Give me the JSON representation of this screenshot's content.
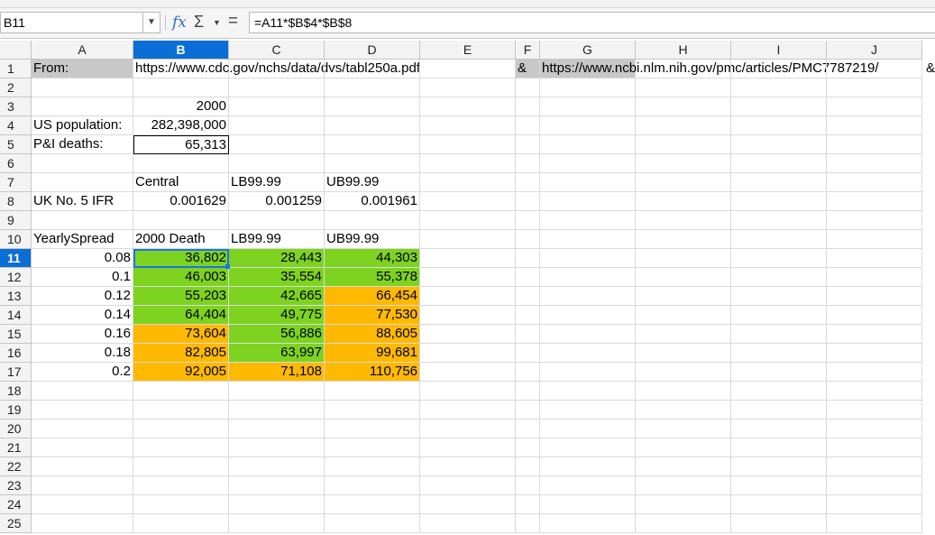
{
  "window": {
    "title": ""
  },
  "formula_bar": {
    "name_box": "B11",
    "formula": "=A11*$B$4*$B$8",
    "fx_icon": "fx-function-wizard-icon",
    "sum_icon": "sum-icon",
    "equals_icon": "equals-icon"
  },
  "colors": {
    "green": "#7ed321",
    "orange": "#ffb900",
    "selection": "#0b6ed7",
    "grey": "#c8c8c8"
  },
  "columns": [
    "A",
    "B",
    "C",
    "D",
    "E",
    "F",
    "G",
    "H",
    "I",
    "J"
  ],
  "selected_column": "B",
  "selected_row": "11",
  "rows": [
    "1",
    "2",
    "3",
    "4",
    "5",
    "6",
    "7",
    "8",
    "9",
    "10",
    "11",
    "12",
    "13",
    "14",
    "15",
    "16",
    "17",
    "18",
    "19",
    "20",
    "21",
    "22",
    "23",
    "24",
    "25"
  ],
  "cells": {
    "A1": "From:",
    "B1": "https://www.cdc.gov/nchs/data/dvs/tabl250a.pdf",
    "F1": "&",
    "G1": "https://www.ncbi.nlm.nih.gov/pmc/articles/PMC7787219/",
    "J1_overflow": "&",
    "B3": "2000",
    "A4": "US population:",
    "B4": "282,398,000",
    "A5": "P&I deaths:",
    "B5": "65,313",
    "B7": "Central",
    "C7": "LB99.99",
    "D7": "UB99.99",
    "A8": "UK No. 5 IFR",
    "B8": "0.001629",
    "C8": "0.001259",
    "D8": "0.001961",
    "A10": "YearlySpread",
    "B10": "2000 Death",
    "C10": "LB99.99",
    "D10": "UB99.99",
    "A11": "0.08",
    "B11": "36,802",
    "C11": "28,443",
    "D11": "44,303",
    "A12": "0.1",
    "B12": "46,003",
    "C12": "35,554",
    "D12": "55,378",
    "A13": "0.12",
    "B13": "55,203",
    "C13": "42,665",
    "D13": "66,454",
    "A14": "0.14",
    "B14": "64,404",
    "C14": "49,775",
    "D14": "77,530",
    "A15": "0.16",
    "B15": "73,604",
    "C15": "56,886",
    "D15": "88,605",
    "A16": "0.18",
    "B16": "82,805",
    "C16": "63,997",
    "D16": "99,681",
    "A17": "0.2",
    "B17": "92,005",
    "C17": "71,108",
    "D17": "110,756"
  }
}
